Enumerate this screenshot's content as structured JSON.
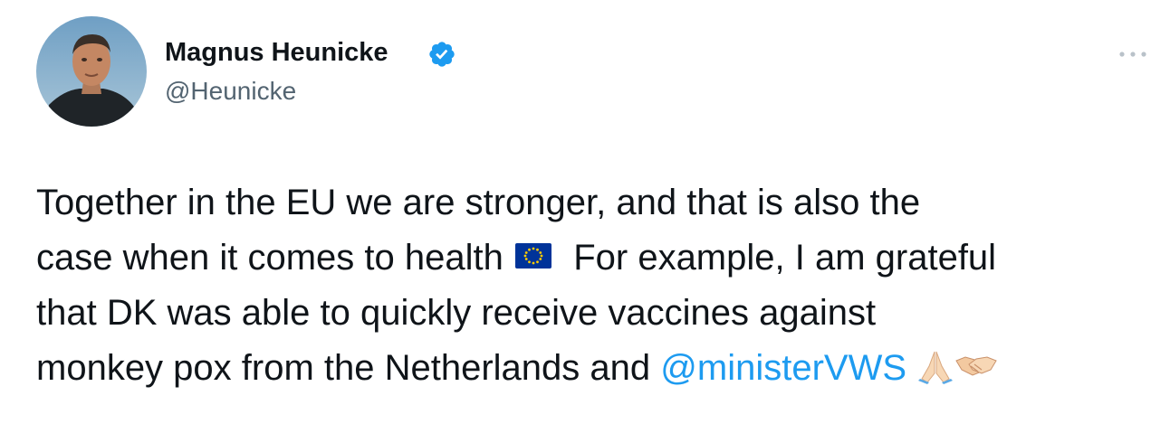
{
  "author": {
    "display_name": "Magnus Heunicke",
    "handle": "@Heunicke",
    "verified_badge_icon": "verified-check-icon",
    "avatar_icon": "profile-photo"
  },
  "menu": {
    "more_icon": "more-dots-icon"
  },
  "tweet": {
    "line1": "Together in the EU we are stronger, and that is also the",
    "line2_before_flag": "case when it comes to health",
    "line2_after_flag": "For example, I am grateful",
    "line3": "that DK was able to quickly receive vaccines against",
    "line4_before_mention": "monkey pox from the Netherlands and",
    "mention": "@ministerVWS",
    "emojis": [
      "eu-flag-emoji",
      "folded-hands-emoji",
      "handshake-emoji"
    ]
  },
  "colors": {
    "text": "#0f1419",
    "secondary": "#536471",
    "link": "#1d9bf0",
    "verified": "#1d9bf0"
  }
}
